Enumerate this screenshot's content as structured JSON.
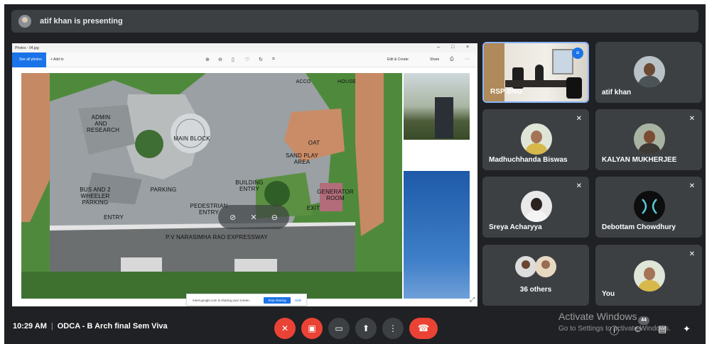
{
  "presenting": {
    "text": "atif khan is presenting"
  },
  "shared_window": {
    "title": "Photos - 04.jpg",
    "toolbar": {
      "see_all": "See all photos",
      "add": "Add to",
      "edit": "Edit & Create",
      "share": "Share"
    },
    "window_controls": [
      "–",
      "□",
      "×"
    ],
    "map_labels": {
      "admin": "ADMIN AND RESEARCH",
      "main_block": "MAIN BLOCK",
      "oat": "OAT",
      "sand_play": "SAND PLAY AREA",
      "bus": "BUS AND 2 WHEELER PARKING",
      "parking": "PARKING",
      "building_entry": "BUILDING ENTRY",
      "pedestrian_entry": "PEDESTRIAN ENTRY",
      "entry": "ENTRY",
      "exit": "EXIT",
      "generator": "GENERATOR ROOM",
      "expressway": "P.V NARASIMHA RAO EXPRESSWAY",
      "acco": "ACCO",
      "house": "HOUSE"
    },
    "share_notice": {
      "message": "meet.google.com is sharing your screen.",
      "stop": "Stop sharing",
      "hide": "Hide"
    }
  },
  "participants": [
    {
      "name": "RSP BNG",
      "speaking": true
    },
    {
      "name": "atif khan",
      "muted": false
    },
    {
      "name": "Madhuchhanda Biswas",
      "muted": true
    },
    {
      "name": "KALYAN MUKHERJEE",
      "muted": true
    },
    {
      "name": "Sreya Acharyya",
      "muted": true
    },
    {
      "name": "Debottam Chowdhury",
      "muted": true
    },
    {
      "name": "36 others"
    },
    {
      "name": "You",
      "muted": true
    }
  ],
  "meeting": {
    "time": "10:29 AM",
    "separator": "|",
    "title": "ODCA - B Arch final Sem Viva"
  },
  "controls": {
    "mic": "mic-off-icon",
    "camera": "camera-off-icon",
    "captions": "captions-icon",
    "present": "present-icon",
    "more": "more-options-icon",
    "end_call": "end-call-icon"
  },
  "people_count": "44",
  "watermark": {
    "line1": "Activate Windows",
    "line2": "Go to Settings to activate Windows."
  },
  "colors": {
    "end_call": "#ea4335",
    "tile_bg": "#3c4043",
    "background": "#202124",
    "speaking_border": "#8ab4f8"
  }
}
